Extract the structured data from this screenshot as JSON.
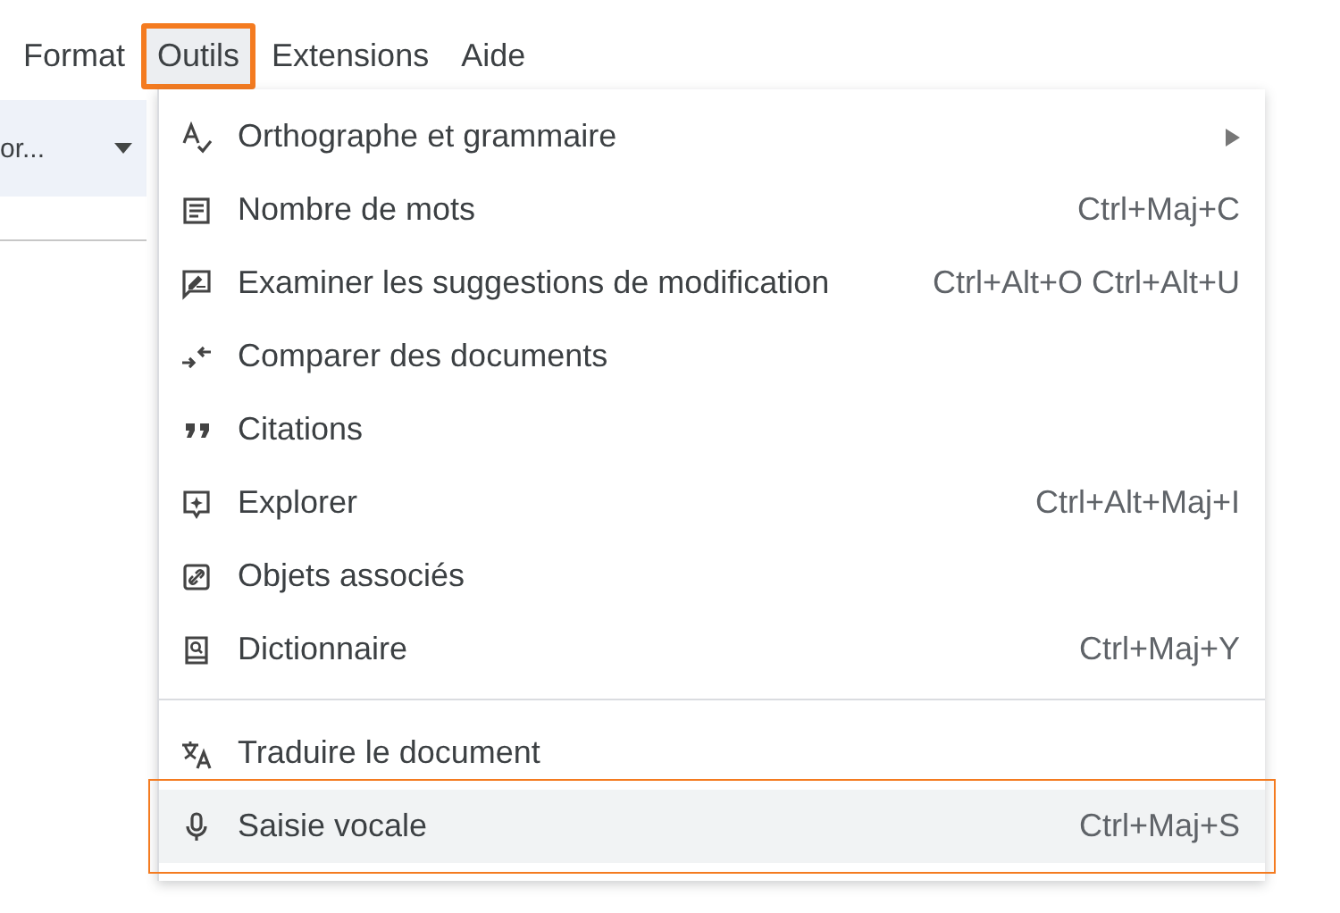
{
  "menubar": [
    {
      "label": "Format",
      "selected": false
    },
    {
      "label": "Outils",
      "selected": true
    },
    {
      "label": "Extensions",
      "selected": false
    },
    {
      "label": "Aide",
      "selected": false
    }
  ],
  "toolbar": {
    "font_field": "or..."
  },
  "menu": [
    {
      "kind": "item",
      "label": "Orthographe et grammaire",
      "submenu": true,
      "selected": false
    },
    {
      "kind": "item",
      "label": "Nombre de mots",
      "shortcut": "Ctrl+Maj+C",
      "selected": false
    },
    {
      "kind": "item",
      "label": "Examiner les suggestions de modification",
      "shortcut": "Ctrl+Alt+O Ctrl+Alt+U",
      "selected": false
    },
    {
      "kind": "item",
      "label": "Comparer des documents",
      "selected": false
    },
    {
      "kind": "item",
      "label": "Citations",
      "selected": false
    },
    {
      "kind": "item",
      "label": "Explorer",
      "shortcut": "Ctrl+Alt+Maj+I",
      "selected": false
    },
    {
      "kind": "item",
      "label": "Objets associés",
      "selected": false
    },
    {
      "kind": "item",
      "label": "Dictionnaire",
      "shortcut": "Ctrl+Maj+Y",
      "selected": false
    },
    {
      "kind": "divider"
    },
    {
      "kind": "item",
      "label": "Traduire le document",
      "selected": false
    },
    {
      "kind": "item",
      "label": "Saisie vocale",
      "shortcut": "Ctrl+Maj+S",
      "selected": true
    }
  ]
}
